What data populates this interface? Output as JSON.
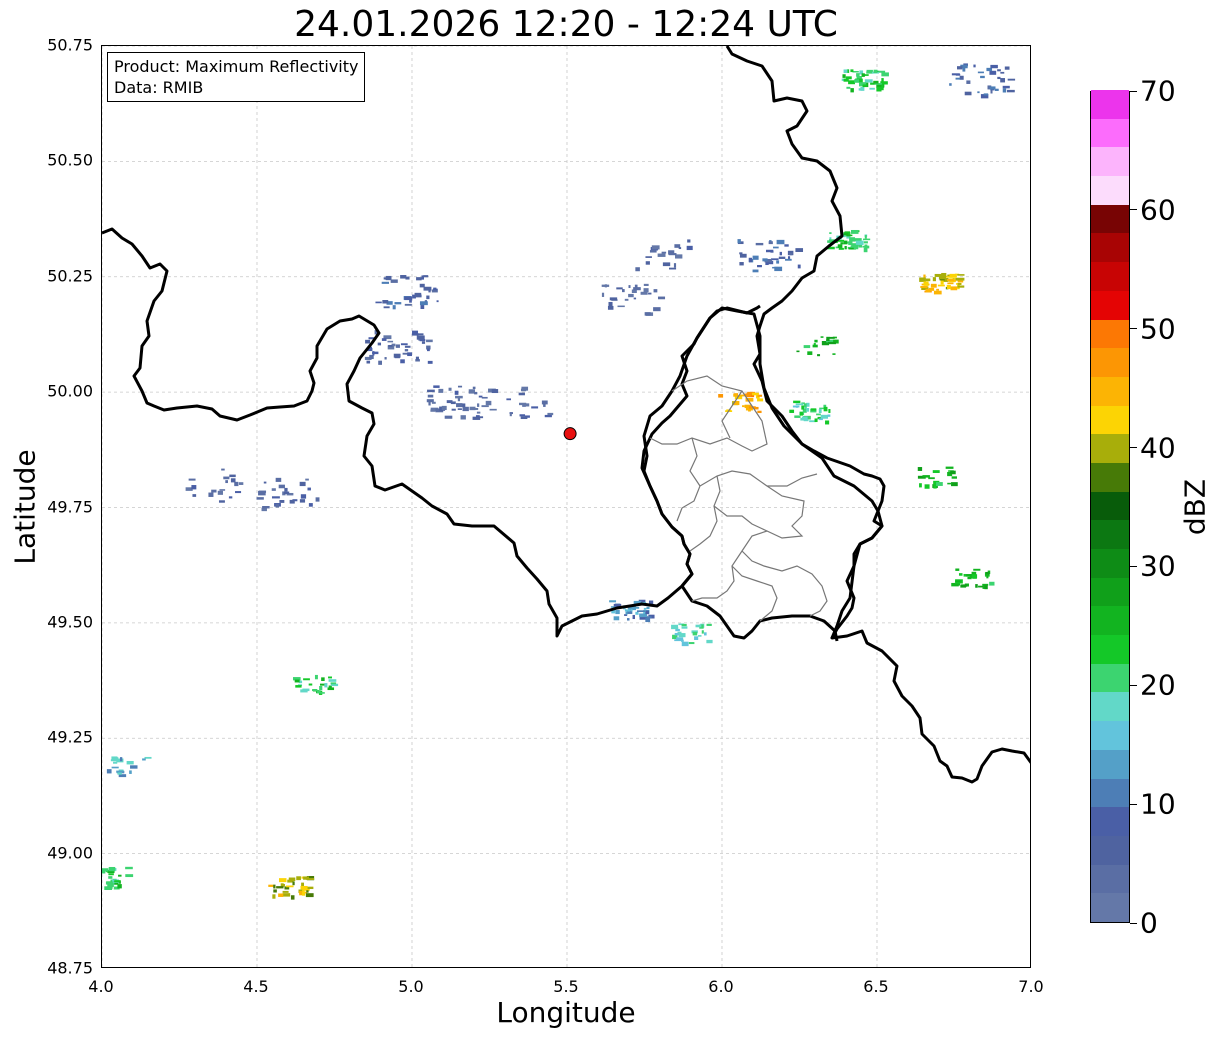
{
  "title": "24.01.2026 12:20 - 12:24 UTC",
  "info_box": {
    "product_line": "Product: Maximum Reflectivity",
    "data_line": "Data: RMIB"
  },
  "axes": {
    "xlabel": "Longitude",
    "ylabel": "Latitude",
    "xlim": [
      4.0,
      7.0
    ],
    "ylim": [
      48.75,
      50.75
    ],
    "x_ticks": [
      "4.0",
      "4.5",
      "5.0",
      "5.5",
      "6.0",
      "6.5",
      "7.0"
    ],
    "y_ticks": [
      "50.75",
      "50.50",
      "50.25",
      "50.00",
      "49.75",
      "49.50",
      "49.25",
      "49.00",
      "48.75"
    ],
    "grid": "dashed light grey"
  },
  "colorbar": {
    "label": "dBZ",
    "ticks": [
      "0",
      "10",
      "20",
      "30",
      "40",
      "50",
      "60",
      "70"
    ],
    "colors": [
      "#6478a8",
      "#5a6ea4",
      "#4f63a0",
      "#4a5fa6",
      "#4d7eb6",
      "#54a0c8",
      "#62c4dc",
      "#62d8c8",
      "#3cd470",
      "#14c828",
      "#12b420",
      "#10a01a",
      "#0e8c16",
      "#0c7812",
      "#085c0a",
      "#477a07",
      "#a8ae0a",
      "#fcd404",
      "#fcb404",
      "#fc9604",
      "#fc7804",
      "#e40404",
      "#c80404",
      "#a80404",
      "#780404",
      "#fcdcfc",
      "#fcb4fc",
      "#fc6cfc",
      "#ec34ec"
    ]
  },
  "radar_site": {
    "lon": 5.51,
    "lat": 49.91,
    "color": "#e81010"
  },
  "chart_data": {
    "type": "map",
    "projection": "plate carree (lon/lat)",
    "radar_site": {
      "lon": 5.51,
      "lat": 49.91
    },
    "echo_regions": [
      {
        "lon": 4.35,
        "lat": 49.8,
        "dbz": 5
      },
      {
        "lon": 4.6,
        "lat": 49.78,
        "dbz": 5
      },
      {
        "lon": 4.98,
        "lat": 50.22,
        "dbz": 8
      },
      {
        "lon": 4.95,
        "lat": 50.1,
        "dbz": 5
      },
      {
        "lon": 5.8,
        "lat": 50.3,
        "dbz": 5
      },
      {
        "lon": 5.7,
        "lat": 50.2,
        "dbz": 4
      },
      {
        "lon": 6.15,
        "lat": 50.3,
        "dbz": 8
      },
      {
        "lon": 6.4,
        "lat": 50.33,
        "dbz": 22
      },
      {
        "lon": 6.3,
        "lat": 50.1,
        "dbz": 25
      },
      {
        "lon": 6.05,
        "lat": 49.98,
        "dbz": 45
      },
      {
        "lon": 6.28,
        "lat": 49.96,
        "dbz": 20
      },
      {
        "lon": 5.15,
        "lat": 49.98,
        "dbz": 4
      },
      {
        "lon": 5.35,
        "lat": 49.98,
        "dbz": 5
      },
      {
        "lon": 5.9,
        "lat": 49.48,
        "dbz": 18
      },
      {
        "lon": 5.7,
        "lat": 49.53,
        "dbz": 12
      },
      {
        "lon": 6.7,
        "lat": 50.24,
        "dbz": 42
      },
      {
        "lon": 6.68,
        "lat": 49.82,
        "dbz": 25
      },
      {
        "lon": 6.8,
        "lat": 49.6,
        "dbz": 25
      },
      {
        "lon": 4.6,
        "lat": 48.93,
        "dbz": 40
      },
      {
        "lon": 4.02,
        "lat": 48.95,
        "dbz": 22
      },
      {
        "lon": 4.08,
        "lat": 49.19,
        "dbz": 15
      },
      {
        "lon": 4.68,
        "lat": 49.37,
        "dbz": 22
      },
      {
        "lon": 6.83,
        "lat": 50.68,
        "dbz": 8
      },
      {
        "lon": 6.45,
        "lat": 50.68,
        "dbz": 22
      }
    ]
  }
}
